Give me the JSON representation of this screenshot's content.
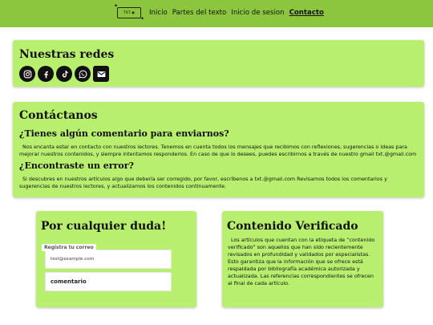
{
  "nav": {
    "logo_text": "TXT ◉",
    "items": [
      {
        "label": "Inicio",
        "active": false
      },
      {
        "label": "Partes del texto",
        "active": false
      },
      {
        "label": "Inicio de sesion",
        "active": false
      },
      {
        "label": "Contacto",
        "active": true
      }
    ]
  },
  "redes": {
    "title": "Nuestras redes",
    "icons": [
      "instagram-icon",
      "facebook-icon",
      "tiktok-icon",
      "whatsapp-icon",
      "gmail-icon"
    ]
  },
  "contact": {
    "title": "Contáctanos",
    "q1": "¿Tienes algún comentario para enviarnos?",
    "p1": "Nos encanta estar en contacto con nuestros lectores. Tenemos en cuenta todos los mensajes que recibimos con reflexiones, sugerencias o ideas para mejorar nuestros contenidos, y siempre intentamos responderlos. En caso de que lo desees, puedes escribirnos a través de nuestro gmail txt.@gmail.com",
    "q2": "¿Encontraste un error?",
    "p2": "Si descubres en nuestros artículos algo que debería ser corregido, por favor, escríbenos a txt.@gmail.com Revisamos todos los comentarios y sugerencias de nuestros lectores, y actualizamos los contenidos continuamente."
  },
  "duda": {
    "title": "Por cualquier duda!",
    "email_label": "Registra tu correo",
    "email_placeholder": "test@example.com",
    "comment_placeholder": "comentario"
  },
  "verificado": {
    "title": "Contenido Verificado",
    "text": "Los artículos que cuentan con la etiqueta de “contenido verificado” son aquellos que han sido recientemente revisados en profundidad y validados por especialistas. Esto garantiza que la información que se ofrece está respaldada por bibliografía académica autorizada y actualizada. Las referencias correspondientes se ofrecen al final de cada artículo."
  },
  "colors": {
    "topbar": "#8cc63f",
    "card": "#b9ef6f"
  }
}
